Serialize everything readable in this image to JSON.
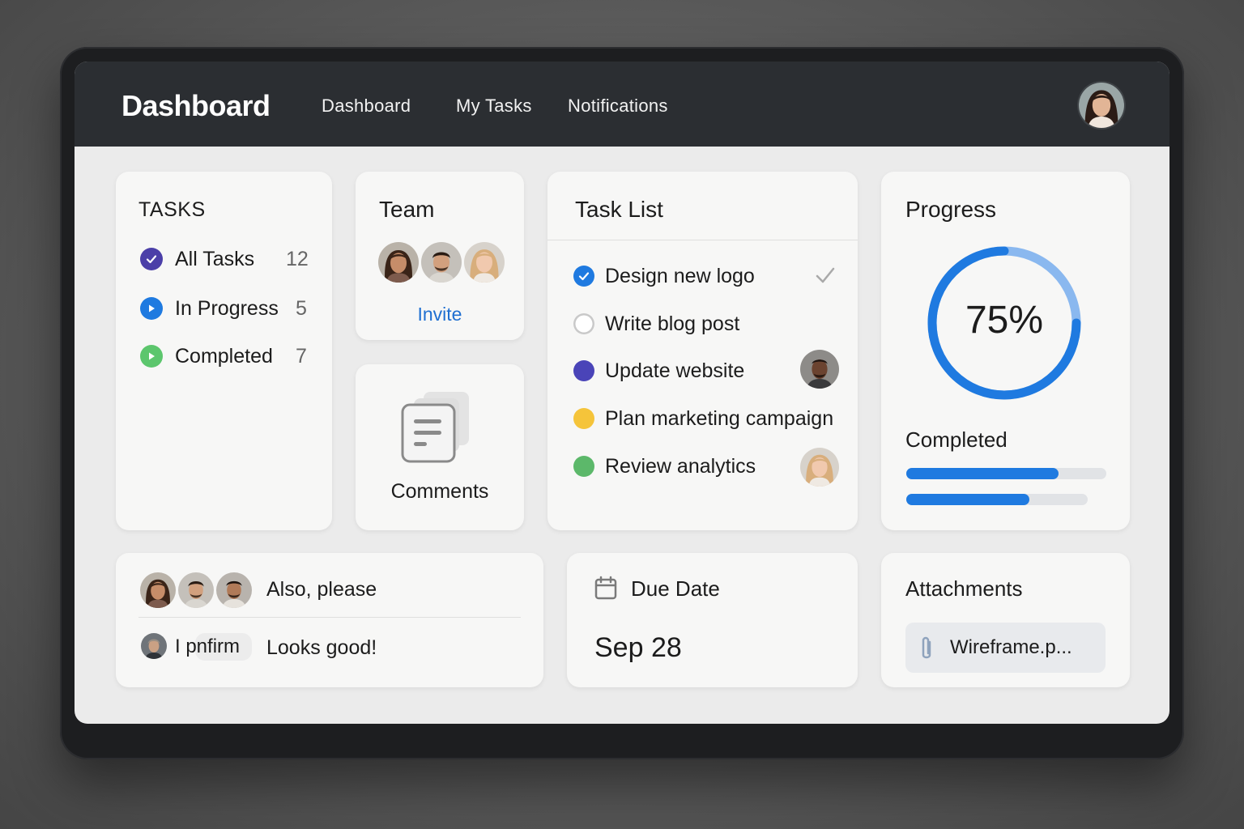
{
  "header": {
    "brand": "Dashboard",
    "nav": [
      "Dashboard",
      "My Tasks",
      "Notifications"
    ]
  },
  "tasks_card": {
    "title": "TASKS",
    "items": [
      {
        "label": "All Tasks",
        "count": "12",
        "icon": "check-circle-icon",
        "color": "#4b3fa8"
      },
      {
        "label": "In Progress",
        "count": "5",
        "icon": "play-circle-icon",
        "color": "#1f7ae0"
      },
      {
        "label": "Completed",
        "count": "7",
        "icon": "play-circle-icon",
        "color": "#5cc66d"
      }
    ]
  },
  "team_card": {
    "title": "Team",
    "invite_label": "Invite"
  },
  "comments_card": {
    "label": "Comments",
    "icon": "documents-icon"
  },
  "task_list": {
    "title": "Task List",
    "items": [
      {
        "label": "Design new logo",
        "status": "done",
        "color": "#1f7ae0"
      },
      {
        "label": "Write blog post",
        "status": "open",
        "color": "#cfcfcf"
      },
      {
        "label": "Update website",
        "status": "dot",
        "color": "#4a44b8"
      },
      {
        "label": "Plan marketing campaign",
        "status": "dot",
        "color": "#f5c43a"
      },
      {
        "label": "Review analytics",
        "status": "dot",
        "color": "#5cb86a"
      }
    ]
  },
  "progress": {
    "title": "Progress",
    "percent_label": "75%",
    "percent": 75,
    "completed_label": "Completed",
    "bars": [
      0.76,
      0.68
    ],
    "accent": "#1f7ae0"
  },
  "activity": {
    "message1": "Also, please",
    "user_tag": "I pnfirm",
    "message2": "Looks good!"
  },
  "due_date": {
    "title": "Due Date",
    "value": "Sep 28",
    "icon": "calendar-icon"
  },
  "attachments": {
    "title": "Attachments",
    "file": "Wireframe.p...",
    "icon": "paperclip-icon"
  }
}
